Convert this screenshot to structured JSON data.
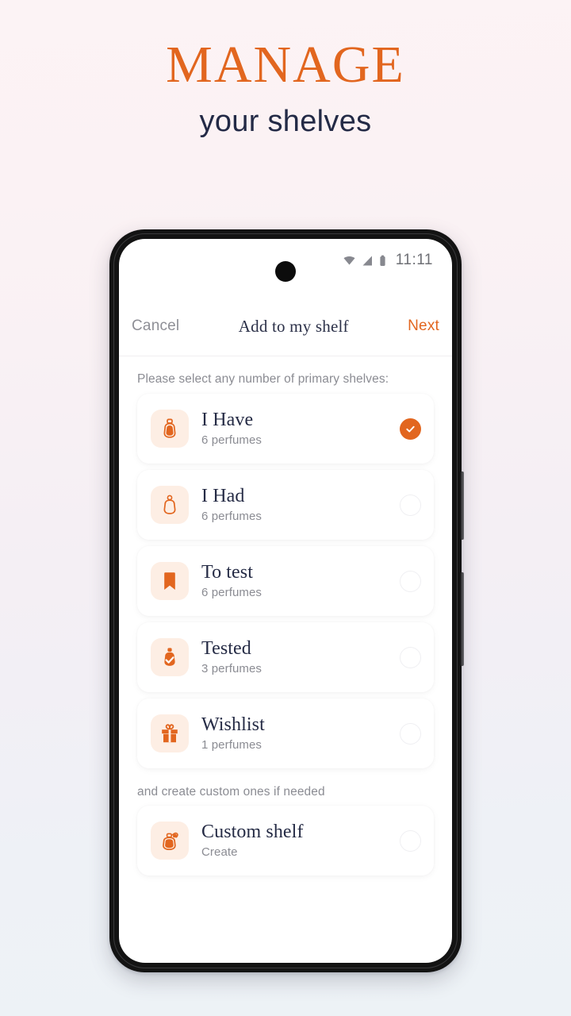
{
  "promo": {
    "title": "MANAGE",
    "subtitle": "your shelves",
    "title_color": "#e2661f",
    "subtitle_color": "#232a46"
  },
  "phone": {
    "statusbar": {
      "time": "11:11",
      "icons": [
        "wifi-icon",
        "cellular-signal-icon",
        "battery-icon"
      ]
    },
    "navbar": {
      "cancel_label": "Cancel",
      "title": "Add to my shelf",
      "next_label": "Next",
      "next_color": "#e2661f"
    },
    "content": {
      "primary_section_label": "Please select any number of primary shelves:",
      "custom_section_label": "and create custom ones if needed",
      "accent_color": "#e2661f",
      "tile_bg": "#fdeee4",
      "primary_shelves": [
        {
          "title": "I Have",
          "subtitle": "6 perfumes",
          "icon": "perfume-bottle-filled-icon",
          "selected": true
        },
        {
          "title": "I Had",
          "subtitle": "6 perfumes",
          "icon": "perfume-bottle-outline-icon",
          "selected": false
        },
        {
          "title": "To test",
          "subtitle": "6 perfumes",
          "icon": "bookmark-icon",
          "selected": false
        },
        {
          "title": "Tested",
          "subtitle": "3 perfumes",
          "icon": "perfume-bottle-check-icon",
          "selected": false
        },
        {
          "title": "Wishlist",
          "subtitle": "1 perfumes",
          "icon": "gift-icon",
          "selected": false
        }
      ],
      "custom_shelves": [
        {
          "title": "Custom shelf",
          "subtitle": "Create",
          "icon": "perfume-atomizer-icon",
          "selected": false
        }
      ]
    }
  }
}
